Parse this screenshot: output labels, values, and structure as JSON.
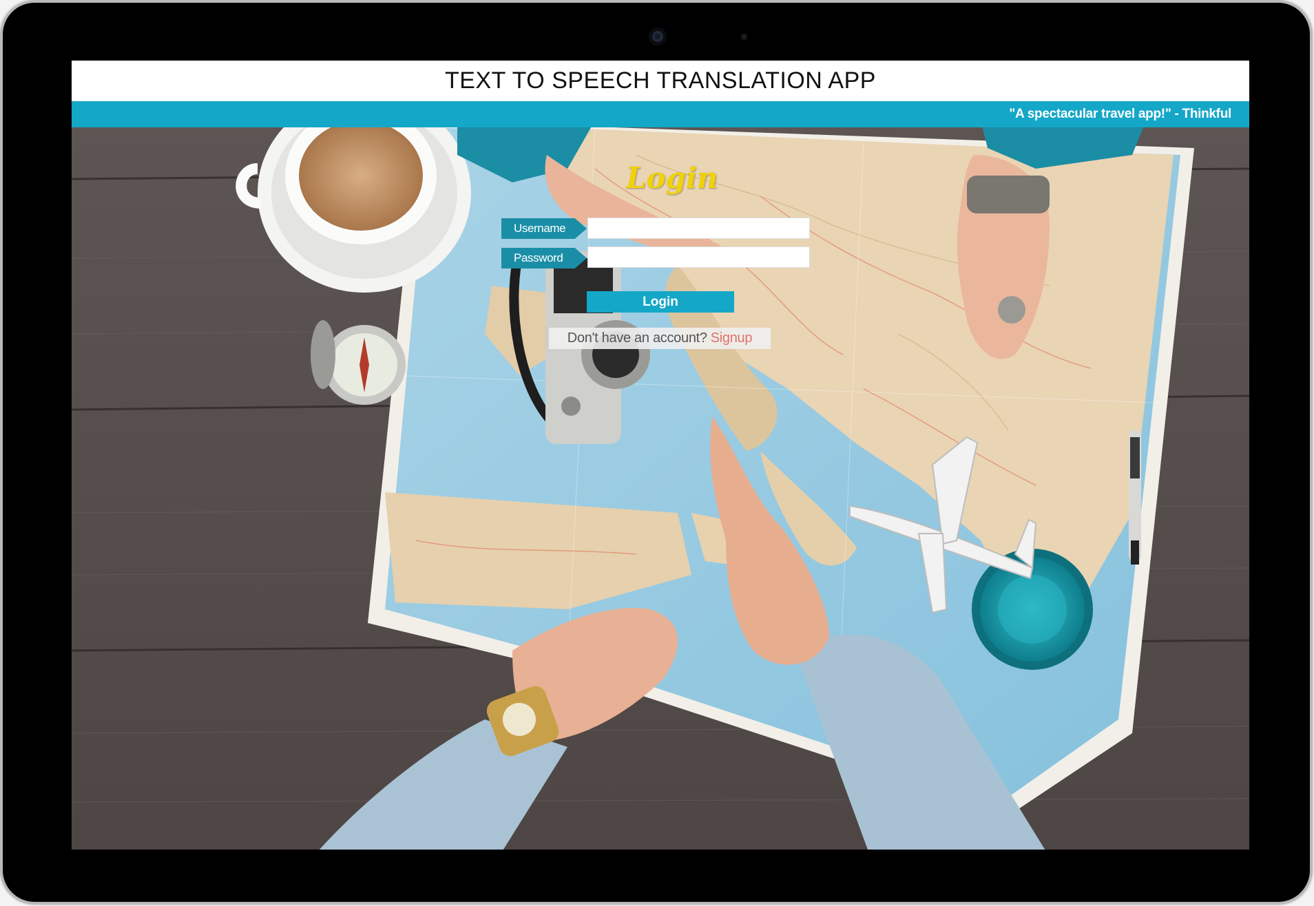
{
  "header": {
    "title": "TEXT TO SPEECH TRANSLATION APP",
    "tagline": "\"A spectacular travel app!\" - Thinkful"
  },
  "login": {
    "heading": "Login",
    "username_label": "Username",
    "username_value": "",
    "password_label": "Password",
    "password_value": "",
    "submit_label": "Login",
    "signup_prompt": "Don't have an account?",
    "signup_link": "Signup"
  },
  "colors": {
    "accent": "#15a7c7",
    "label_bg": "#1a8ea6",
    "heading": "#f1d20a",
    "signup_link": "#e0726a"
  }
}
